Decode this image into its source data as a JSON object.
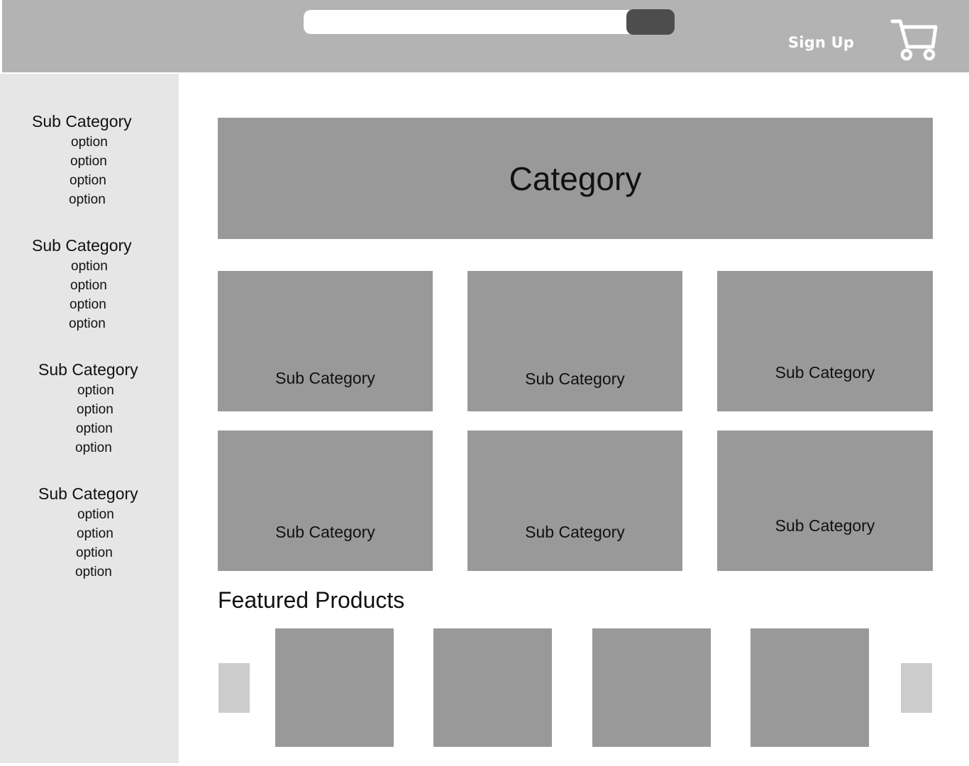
{
  "header": {
    "search_placeholder": "",
    "signup_label": "Sign Up",
    "cart_icon": "shopping-cart-icon"
  },
  "sidebar": {
    "groups": [
      {
        "title": "Sub Category",
        "options": [
          "option",
          "option",
          "option",
          "option"
        ]
      },
      {
        "title": "Sub Category",
        "options": [
          "option",
          "option",
          "option",
          "option"
        ]
      },
      {
        "title": "Sub Category",
        "options": [
          "option",
          "option",
          "option",
          "option"
        ]
      },
      {
        "title": "Sub Category",
        "options": [
          "option",
          "option",
          "option",
          "option"
        ]
      }
    ]
  },
  "main": {
    "hero_title": "Category",
    "tiles": [
      {
        "label": "Sub Category"
      },
      {
        "label": "Sub Category"
      },
      {
        "label": "Sub Category"
      },
      {
        "label": "Sub Category"
      },
      {
        "label": "Sub Category"
      },
      {
        "label": "Sub Category"
      }
    ],
    "featured_title": "Featured Products"
  },
  "colors": {
    "header_bg": "#b3b3b3",
    "sidebar_bg": "#e6e6e6",
    "placeholder_block": "#999999",
    "search_button": "#4d4d4d",
    "arrow_block": "#cccccc"
  }
}
